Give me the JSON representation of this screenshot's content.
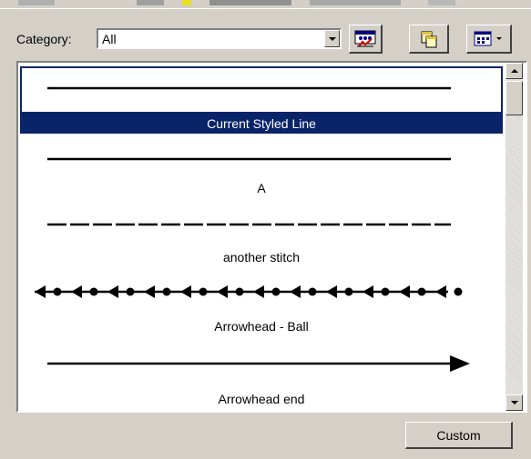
{
  "category": {
    "label": "Category:",
    "selected": "All"
  },
  "toolbar": {
    "buttons": [
      {
        "name": "style-references-button",
        "icon": "style-references-icon"
      },
      {
        "name": "copy-button",
        "icon": "copy-icon"
      },
      {
        "name": "view-options-button",
        "icon": "view-options-dropdown-icon"
      }
    ]
  },
  "list": {
    "items": [
      {
        "label": "Current Styled Line",
        "style": "solid",
        "selected": true
      },
      {
        "label": "A",
        "style": "solid",
        "selected": false
      },
      {
        "label": "another stitch",
        "style": "dashed",
        "selected": false
      },
      {
        "label": "Arrowhead - Ball",
        "style": "arrow-ball",
        "selected": false
      },
      {
        "label": "Arrowhead end",
        "style": "arrow-end",
        "selected": false
      }
    ]
  },
  "actions": {
    "custom_label": "Custom"
  },
  "colors": {
    "dialog_bg": "#d4d0c8",
    "selection_bg": "#0a246a",
    "selection_text": "#ffffff"
  }
}
